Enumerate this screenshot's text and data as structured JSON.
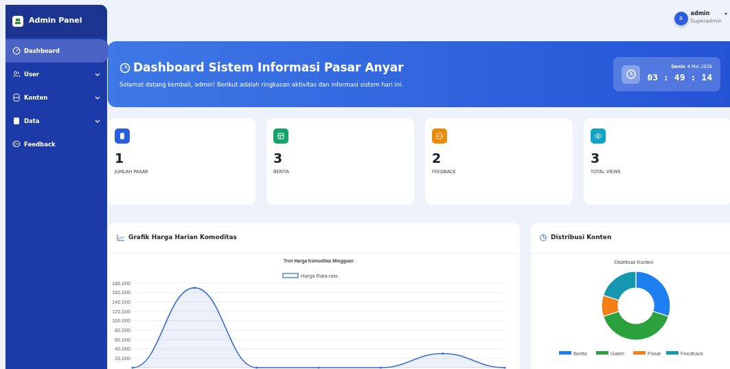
{
  "sidebar": {
    "brand": "Admin Panel",
    "items": [
      {
        "label": "Dashboard",
        "kind": "gauge",
        "selected": true,
        "expandable": false
      },
      {
        "label": "User",
        "kind": "users",
        "selected": false,
        "expandable": true
      },
      {
        "label": "Konten",
        "kind": "doc",
        "selected": false,
        "expandable": true
      },
      {
        "label": "Data",
        "kind": "db",
        "selected": false,
        "expandable": true
      },
      {
        "label": "Feedback",
        "kind": "chat",
        "selected": false,
        "expandable": false
      }
    ]
  },
  "user": {
    "avatar": "a",
    "name": "admin",
    "role": "Superadmin"
  },
  "hero": {
    "title": "Dashboard Sistem Informasi Pasar Anyar",
    "subtitle": "Selamat datang kembali, admin! Berikut adalah ringkasan aktivitas dan informasi sistem hari ini.",
    "day": "Senin",
    "date": "4 Mei 2026",
    "hours": "03",
    "minutes": "49",
    "seconds": "14",
    "separator": ":"
  },
  "stats": [
    {
      "value": "1",
      "label": "JUMLAH PASAR",
      "kind": "store",
      "color": "#2a5de0"
    },
    {
      "value": "3",
      "label": "BERITA",
      "kind": "news",
      "color": "#16a36a"
    },
    {
      "value": "2",
      "label": "FEEDBACK",
      "kind": "chat",
      "color": "#ec8a0c"
    },
    {
      "value": "3",
      "label": "TOTAL VIEWS",
      "kind": "eye",
      "color": "#12a4c4"
    }
  ],
  "line_card": {
    "title": "Grafik Harga Harian Komoditas",
    "chart_data": {
      "type": "line",
      "title": "Tren Harga Komoditas Mingguan",
      "series": [
        {
          "name": "Harga Rata-rata",
          "color": "#3a6fd0",
          "values": [
            0,
            170000,
            0,
            0,
            0,
            30000,
            0
          ]
        }
      ],
      "grid": true,
      "legend": "top",
      "ylim": [
        0,
        180000
      ],
      "yticks": [
        {
          "value": 20000,
          "label": "20,000"
        },
        {
          "value": 40000,
          "label": "40,000"
        },
        {
          "value": 60000,
          "label": "60,000"
        },
        {
          "value": 80000,
          "label": "80,000"
        },
        {
          "value": 100000,
          "label": "100,000"
        },
        {
          "value": 120000,
          "label": "120,000"
        },
        {
          "value": 140000,
          "label": "140,000"
        },
        {
          "value": 160000,
          "label": "160,000"
        },
        {
          "value": 180000,
          "label": "180,000"
        }
      ]
    }
  },
  "donut_card": {
    "title": "Distribusi Konten",
    "chart_data": {
      "type": "donut",
      "title": "Distribusi Konten",
      "categories": [
        "Berita",
        "Galeri",
        "Pasar",
        "Feedback"
      ],
      "values": [
        30,
        40,
        10,
        20
      ],
      "legend": "bottom",
      "colors": [
        "#1e7ff0",
        "#2aa13c",
        "#f57f17",
        "#1597b0"
      ]
    }
  }
}
